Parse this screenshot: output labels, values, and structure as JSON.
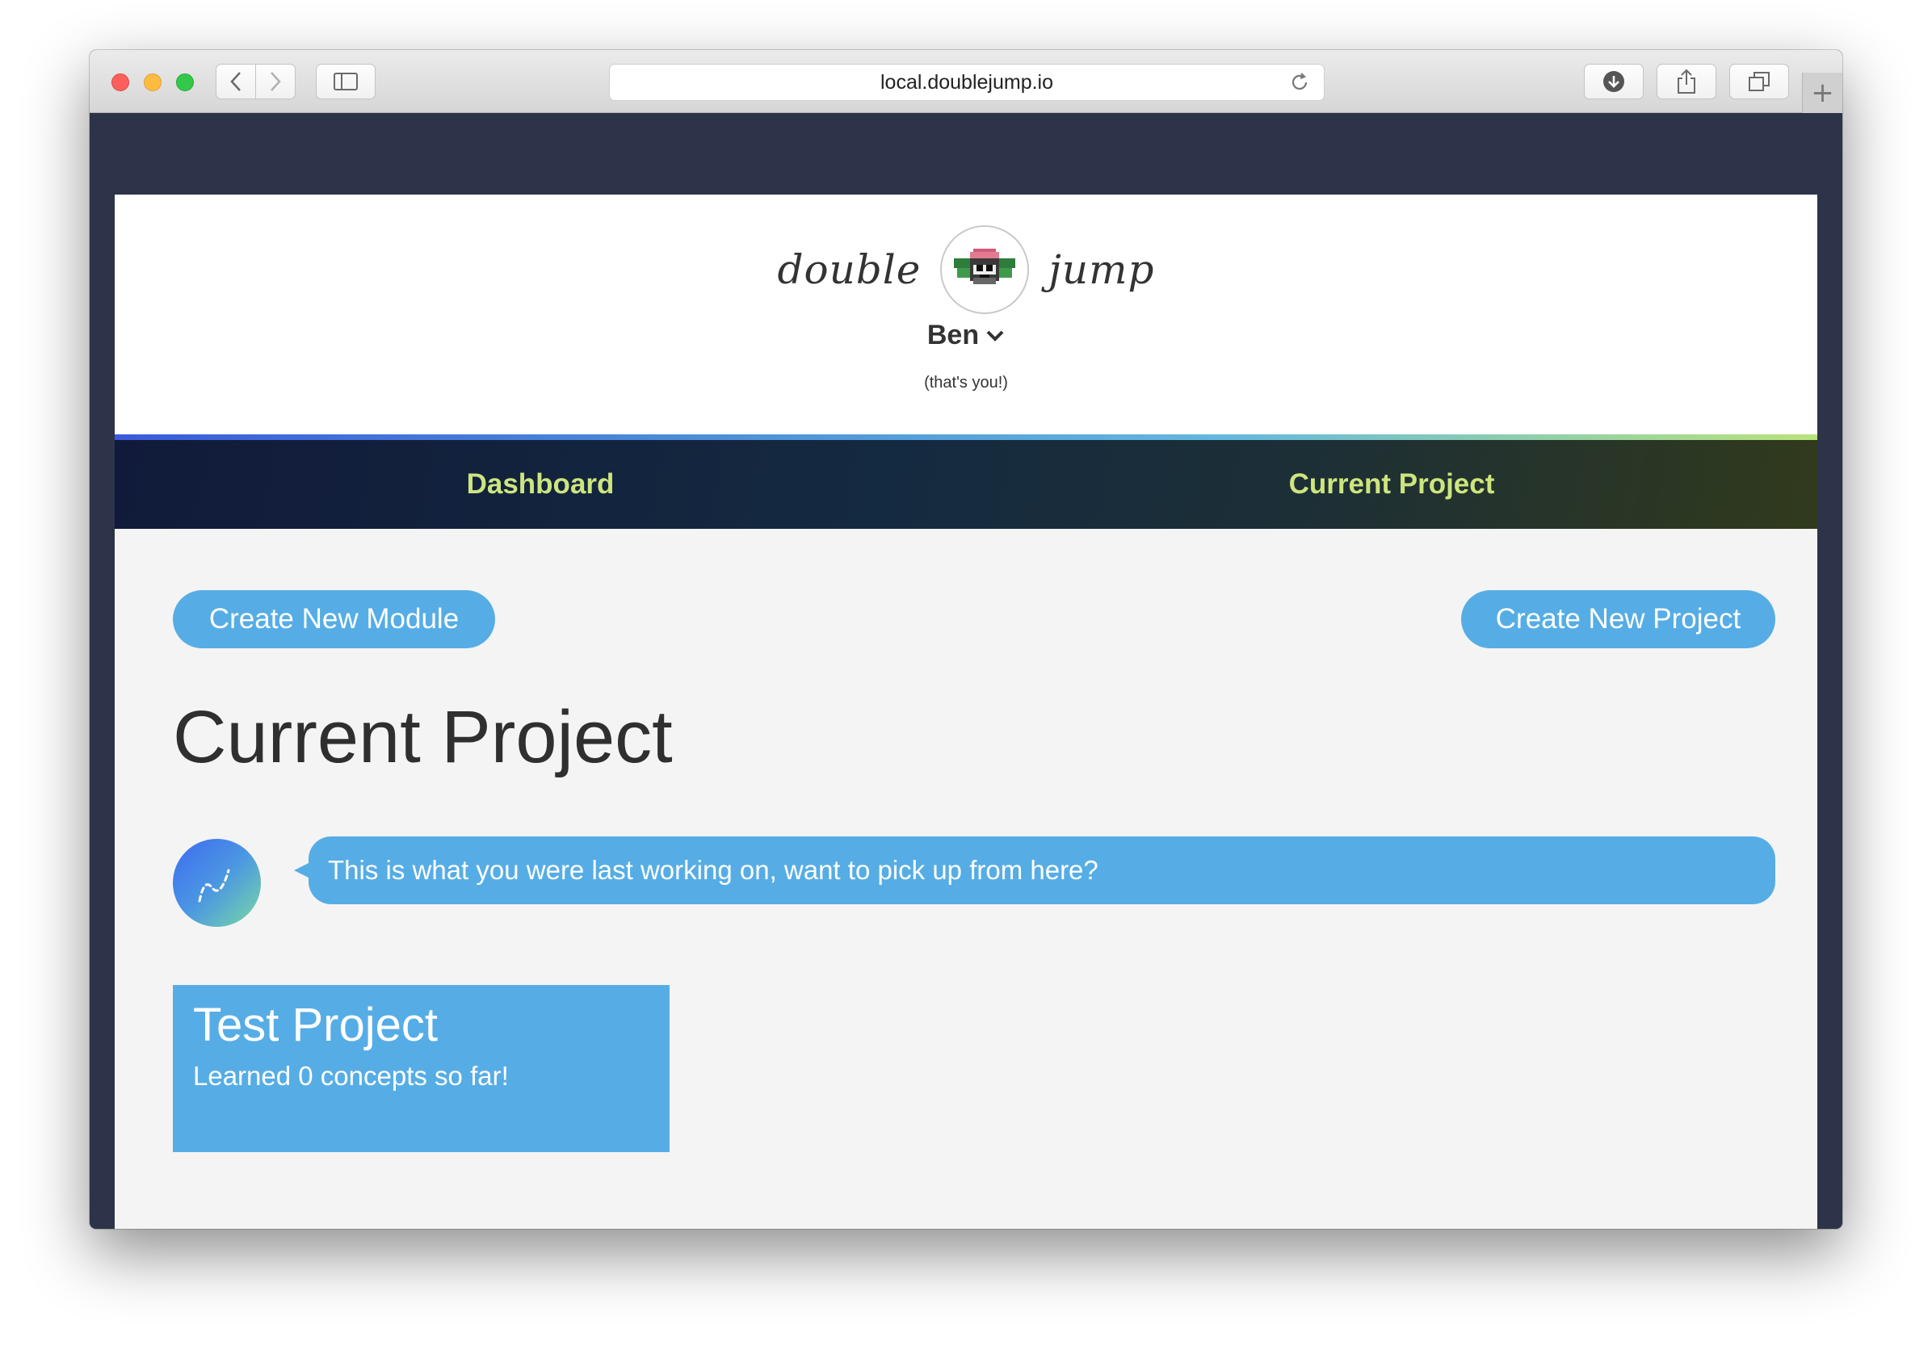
{
  "browser": {
    "url": "local.doublejump.io",
    "buttons": {
      "back": "chevron-left-icon",
      "forward": "chevron-right-icon",
      "sidebar": "sidebar-icon",
      "reload": "reload-icon",
      "download": "download-icon",
      "share": "share-icon",
      "tabs": "tabs-icon",
      "new_tab": "+"
    }
  },
  "header": {
    "logo_left": "double",
    "logo_right": "jump",
    "user_name": "Ben",
    "user_note": "(that's you!)"
  },
  "nav": {
    "items": [
      {
        "label": "Dashboard"
      },
      {
        "label": "Current Project"
      }
    ],
    "accent_color": "#cde57e"
  },
  "actions": {
    "create_module": "Create New Module",
    "create_project": "Create New Project"
  },
  "main": {
    "title": "Current Project",
    "message": "This is what you were last working on, want to pick up from here?",
    "project_card": {
      "title": "Test Project",
      "subtitle": "Learned 0 concepts so far!"
    }
  },
  "colors": {
    "primary": "#56ade5",
    "frame": "#2d3349"
  }
}
